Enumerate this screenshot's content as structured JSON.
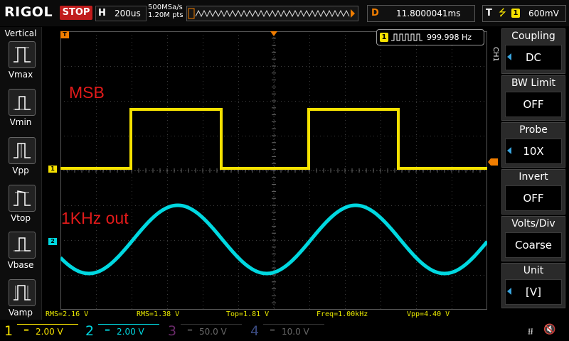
{
  "topbar": {
    "logo": "RIGOL",
    "run_status": "STOP",
    "timebase_label": "H",
    "timebase_value": "200us",
    "sample_rate": "500MSa/s",
    "memory_depth": "1.20M pts",
    "delay_label": "D",
    "delay_value": "11.8000041ms",
    "trigger_label": "T",
    "trigger_icon": "rising-edge-icon",
    "trigger_channel": "1",
    "trigger_level": "600mV"
  },
  "left_panel": {
    "title": "Vertical",
    "items": [
      {
        "label": "Vmax",
        "icon": "vmax-icon"
      },
      {
        "label": "Vmin",
        "icon": "vmin-icon"
      },
      {
        "label": "Vpp",
        "icon": "vpp-icon"
      },
      {
        "label": "Vtop",
        "icon": "vtop-icon"
      },
      {
        "label": "Vbase",
        "icon": "vbase-icon"
      },
      {
        "label": "Vamp",
        "icon": "vamp-icon"
      }
    ]
  },
  "grid": {
    "trigger_marker": "T",
    "ch1_marker": "1",
    "ch2_marker": "2",
    "annotation_top": "MSB",
    "annotation_bottom": "1KHz out",
    "frequency_counter_channel": "1",
    "frequency_counter_value": "999.998 Hz"
  },
  "right_panel": {
    "channel_tab": "CH1",
    "items": [
      {
        "title": "Coupling",
        "value": "DC"
      },
      {
        "title": "BW Limit",
        "value": "OFF"
      },
      {
        "title": "Probe",
        "value": "10X"
      },
      {
        "title": "Invert",
        "value": "OFF"
      },
      {
        "title": "Volts/Div",
        "value": "Coarse"
      },
      {
        "title": "Unit",
        "value": "[V]"
      }
    ]
  },
  "measurements": [
    "RMS=2.16 V",
    "RMS=1.38 V",
    "Top=1.81 V",
    "Freq=1.00kHz",
    "Vpp=4.40 V"
  ],
  "channels": [
    {
      "num": "1",
      "scale": "2.00 V",
      "color": "#f5e100",
      "active": true
    },
    {
      "num": "2",
      "scale": "2.00 V",
      "color": "#00d8e0",
      "active": true
    },
    {
      "num": "3",
      "scale": "50.0 V",
      "color": "#c040c0",
      "active": false
    },
    {
      "num": "4",
      "scale": "10.0 V",
      "color": "#5a7ae0",
      "active": false
    }
  ],
  "colors": {
    "ch1": "#f5e100",
    "ch2": "#00d8e0",
    "trigger": "#f07d00",
    "annotation": "#e21a1a"
  }
}
